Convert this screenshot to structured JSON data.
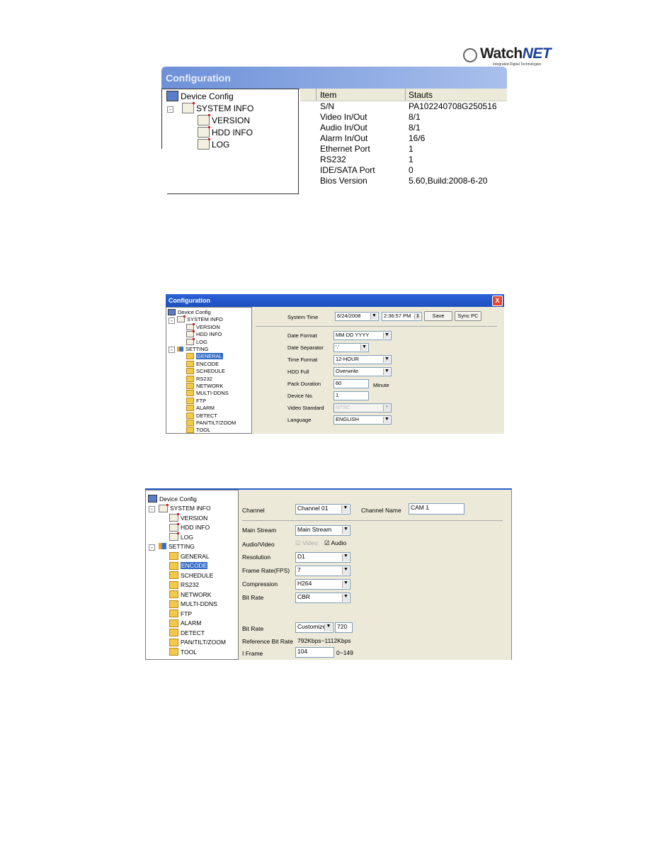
{
  "logo": {
    "brand": "Watch",
    "brand_accent": "NET",
    "tagline": "Integrated Digital Technologies"
  },
  "screenshot1": {
    "title": "Configuration",
    "tree": [
      {
        "label": "Device Config",
        "icon": "computer-icon",
        "level": 0
      },
      {
        "label": "SYSTEM INFO",
        "icon": "note-icon",
        "level": 1,
        "expander": "-"
      },
      {
        "label": "VERSION",
        "icon": "note-icon",
        "level": 2
      },
      {
        "label": "HDD INFO",
        "icon": "note-icon",
        "level": 2
      },
      {
        "label": "LOG",
        "icon": "note-icon",
        "level": 2
      }
    ],
    "table": {
      "headers": [
        "Item",
        "Stauts"
      ],
      "rows": [
        [
          "S/N",
          "PA102240708G250516"
        ],
        [
          "Video In/Out",
          "8/1"
        ],
        [
          "Audio In/Out",
          "8/1"
        ],
        [
          "Alarm In/Out",
          "16/6"
        ],
        [
          "Ethernet Port",
          "1"
        ],
        [
          "RS232",
          "1"
        ],
        [
          "IDE/SATA Port",
          "0"
        ],
        [
          "Bios Version",
          "5.60,Build:2008-6-20"
        ]
      ]
    }
  },
  "screenshot2": {
    "title": "Configuration",
    "close": "X",
    "tree": [
      {
        "label": "Device Config",
        "icon": "computer-icon",
        "level": 0
      },
      {
        "label": "SYSTEM INFO",
        "icon": "note-icon",
        "level": 1,
        "expander": "-"
      },
      {
        "label": "VERSION",
        "icon": "note-icon",
        "level": 2
      },
      {
        "label": "HDD INFO",
        "icon": "note-icon",
        "level": 2
      },
      {
        "label": "LOG",
        "icon": "note-icon",
        "level": 2
      },
      {
        "label": "SETTING",
        "icon": "tool-icon",
        "level": 1,
        "expander": "-"
      },
      {
        "label": "GENERAL",
        "icon": "folder-icon",
        "level": 2,
        "selected": true
      },
      {
        "label": "ENCODE",
        "icon": "folder-icon",
        "level": 2
      },
      {
        "label": "SCHEDULE",
        "icon": "folder-icon",
        "level": 2
      },
      {
        "label": "RS232",
        "icon": "folder-icon",
        "level": 2
      },
      {
        "label": "NETWORK",
        "icon": "folder-icon",
        "level": 2
      },
      {
        "label": "MULTI-DDNS",
        "icon": "folder-icon",
        "level": 2
      },
      {
        "label": "FTP",
        "icon": "folder-icon",
        "level": 2
      },
      {
        "label": "ALARM",
        "icon": "folder-icon",
        "level": 2
      },
      {
        "label": "DETECT",
        "icon": "folder-icon",
        "level": 2
      },
      {
        "label": "PAN/TILT/ZOOM",
        "icon": "folder-icon",
        "level": 2
      },
      {
        "label": "TOOL",
        "icon": "folder-icon",
        "level": 2
      }
    ],
    "system_time_label": "System Time",
    "date_value": "6/24/2008",
    "time_value": "2:36:57 PM",
    "save_label": "Save",
    "sync_label": "Sync PC",
    "date_format_label": "Date Format",
    "date_format_value": "MM DD YYYY",
    "date_separator_label": "Date Separator",
    "date_separator_value": "'.'",
    "time_format_label": "Time Format",
    "time_format_value": "12-HOUR",
    "hdd_full_label": "HDD Full",
    "hdd_full_value": "Overwrite",
    "pack_duration_label": "Pack Duration",
    "pack_duration_value": "60",
    "pack_duration_unit": "Minute",
    "device_no_label": "Device No.",
    "device_no_value": "1",
    "video_standard_label": "Video Standard",
    "video_standard_value": "NTSC",
    "language_label": "Language",
    "language_value": "ENGLISH"
  },
  "screenshot3": {
    "tree": [
      {
        "label": "Device Config",
        "icon": "computer-icon",
        "level": 0
      },
      {
        "label": "SYSTEM INFO",
        "icon": "note-icon",
        "level": 1,
        "expander": "-"
      },
      {
        "label": "VERSION",
        "icon": "note-icon",
        "level": 2
      },
      {
        "label": "HDD INFO",
        "icon": "note-icon",
        "level": 2
      },
      {
        "label": "LOG",
        "icon": "note-icon",
        "level": 2
      },
      {
        "label": "SETTING",
        "icon": "tool-icon",
        "level": 1,
        "expander": "-"
      },
      {
        "label": "GENERAL",
        "icon": "folder-icon",
        "level": 2
      },
      {
        "label": "ENCODE",
        "icon": "folder-icon",
        "level": 2,
        "selected": true
      },
      {
        "label": "SCHEDULE",
        "icon": "folder-icon",
        "level": 2
      },
      {
        "label": "RS232",
        "icon": "folder-icon",
        "level": 2
      },
      {
        "label": "NETWORK",
        "icon": "folder-icon",
        "level": 2
      },
      {
        "label": "MULTI-DDNS",
        "icon": "folder-icon",
        "level": 2
      },
      {
        "label": "FTP",
        "icon": "folder-icon",
        "level": 2
      },
      {
        "label": "ALARM",
        "icon": "folder-icon",
        "level": 2
      },
      {
        "label": "DETECT",
        "icon": "folder-icon",
        "level": 2
      },
      {
        "label": "PAN/TILT/ZOOM",
        "icon": "folder-icon",
        "level": 2
      },
      {
        "label": "TOOL",
        "icon": "folder-icon",
        "level": 2
      }
    ],
    "channel_label": "Channel",
    "channel_value": "Channel 01",
    "channel_name_label": "Channel Name",
    "channel_name_value": "CAM 1",
    "main_stream_label": "Main Stream",
    "main_stream_value": "Main Stream",
    "audio_video_label": "Audio/Video",
    "video_check_label": "Video",
    "video_checked": true,
    "audio_check_label": "Audio",
    "audio_checked": true,
    "resolution_label": "Resolution",
    "resolution_value": "D1",
    "frame_rate_label": "Frame Rate(FPS)",
    "frame_rate_value": "7",
    "compression_label": "Compression",
    "compression_value": "H264",
    "bit_rate_label": "Bit Rate",
    "bit_rate_value": "CBR",
    "bit_rate2_label": "Bit Rate",
    "bit_rate2_value": "Customized",
    "bit_rate2_custom": "720",
    "ref_bit_rate_label": "Reference Bit Rate",
    "ref_bit_rate_value": "792Kbps~1112Kbps",
    "iframe_label": "I Frame",
    "iframe_value": "104",
    "iframe_range": "0~149"
  },
  "colors": {
    "titlebar": "#3b6fd0",
    "selection": "#316ac5",
    "panel": "#ece9d8",
    "close": "#e0482c"
  }
}
